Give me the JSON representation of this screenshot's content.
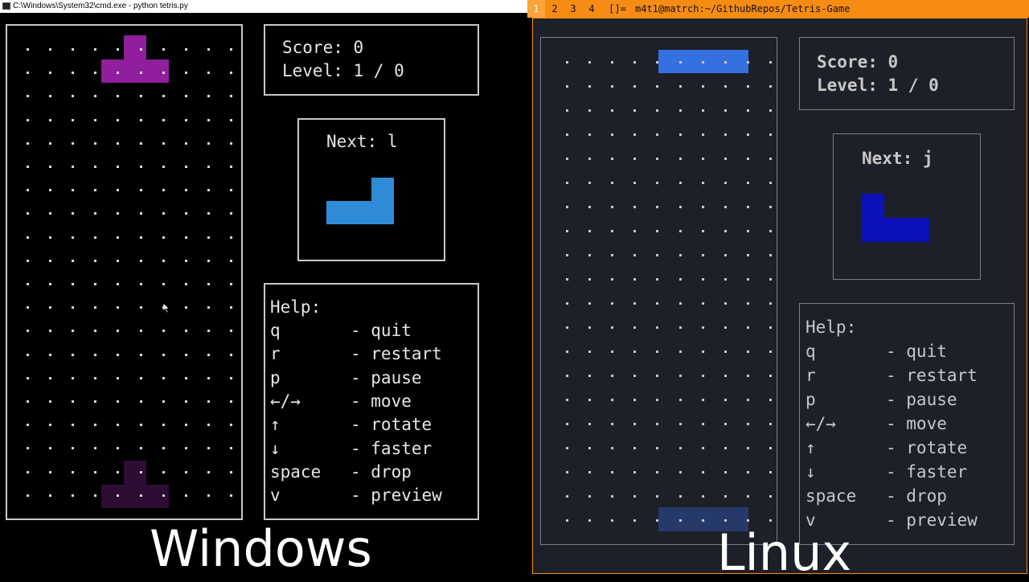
{
  "windows": {
    "title": "C:\\Windows\\System32\\cmd.exe - python  tetris.py",
    "score": "Score: 0",
    "level": "Level: 1 / 0",
    "next": "Next: l",
    "help_title": "Help:",
    "help": [
      {
        "key": "q",
        "desc": "- quit"
      },
      {
        "key": "r",
        "desc": "- restart"
      },
      {
        "key": "p",
        "desc": "- pause"
      },
      {
        "key": "←/→",
        "desc": "- move"
      },
      {
        "key": "↑",
        "desc": "- rotate"
      },
      {
        "key": "↓",
        "desc": "- faster"
      },
      {
        "key": "space",
        "desc": "- drop"
      },
      {
        "key": "v",
        "desc": "- preview"
      }
    ],
    "caption": "Windows",
    "colors": {
      "active": "#8f1f9c",
      "ghost": "#2e0d34",
      "next": "#2f8bd8"
    }
  },
  "linux": {
    "workspaces": [
      "1",
      "2",
      "3",
      "4",
      "[]="
    ],
    "active_workspace": "1",
    "title": "m4t1@matrch:~/GithubRepos/Tetris-Game",
    "score": "Score: 0",
    "level": "Level: 1 / 0",
    "next": "Next: j",
    "help_title": "Help:",
    "help": [
      {
        "key": "q",
        "desc": "- quit"
      },
      {
        "key": "r",
        "desc": "- restart"
      },
      {
        "key": "p",
        "desc": "- pause"
      },
      {
        "key": "←/→",
        "desc": "- move"
      },
      {
        "key": "↑",
        "desc": "- rotate"
      },
      {
        "key": "↓",
        "desc": "- faster"
      },
      {
        "key": "space",
        "desc": "- drop"
      },
      {
        "key": "v",
        "desc": "- preview"
      }
    ],
    "caption": "Linux",
    "colors": {
      "active": "#3470e0",
      "ghost": "#263a6a",
      "next": "#0b10b8",
      "bar": "#f68c14"
    }
  }
}
